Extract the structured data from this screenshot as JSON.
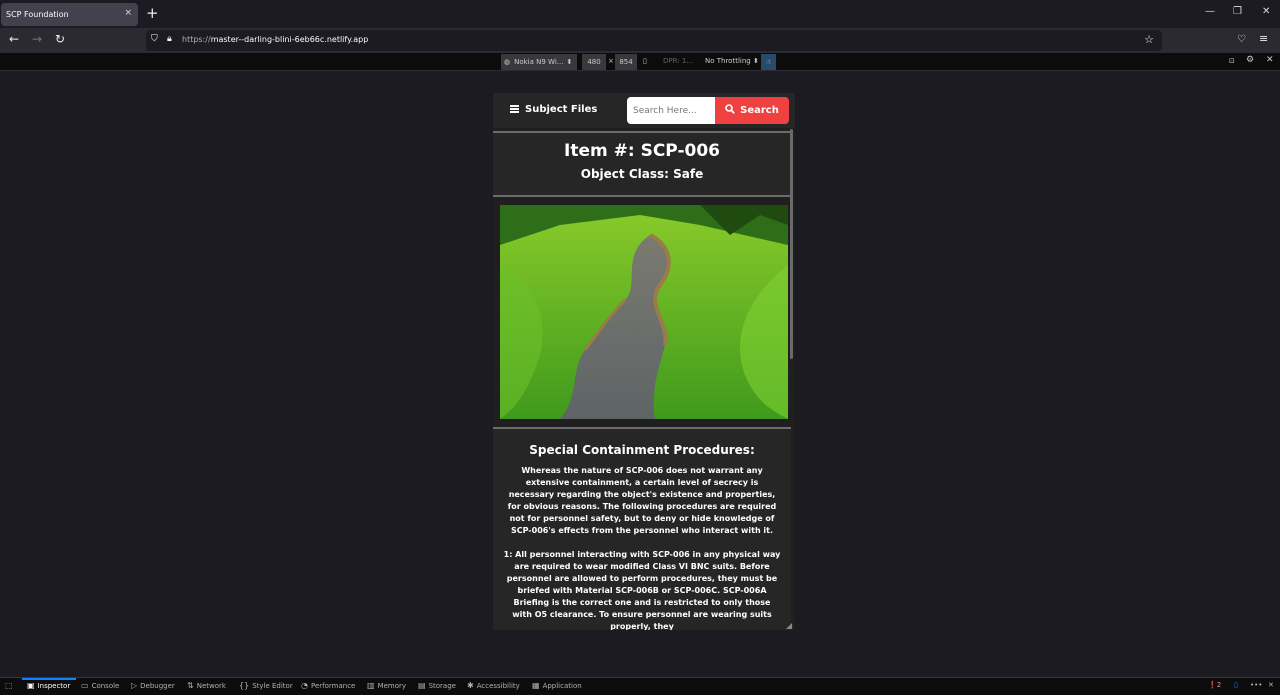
{
  "browser": {
    "tab_title": "SCP Foundation",
    "tab_close": "×",
    "new_tab": "+",
    "url_scheme": "https://",
    "url_host": "master--darling-blini-6eb66c.netlify.app"
  },
  "rdm": {
    "device": "Nokia N9 Wi...",
    "width": "480",
    "x": "×",
    "height": "854",
    "dpr": "DPR: 1...",
    "throttle": "No Throttling"
  },
  "site": {
    "nav": {
      "subject_files": "Subject Files",
      "search_placeholder": "Search Here...",
      "search_button": "Search"
    },
    "item_title": "Item #: SCP-006",
    "object_class": "Object Class: Safe",
    "containment_heading": "Special Containment Procedures:",
    "paragraph_1": "Whereas the nature of SCP-006 does not warrant any extensive containment, a certain level of secrecy is necessary regarding the object's existence and properties, for obvious reasons. The following procedures are required not for personnel safety, but to deny or hide knowledge of SCP-006's effects from the personnel who interact with it.",
    "paragraph_2": "1: All personnel interacting with SCP-006 in any physical way are required to wear modified Class VI BNC suits. Before personnel are allowed to perform procedures, they must be briefed with Material SCP-006B or SCP-006C. SCP-006A Briefing is the correct one and is restricted to only those with O5 clearance. To ensure personnel are wearing suits properly, they"
  },
  "devtools": {
    "tabs": [
      "Inspector",
      "Console",
      "Debugger",
      "Network",
      "Style Editor",
      "Performance",
      "Memory",
      "Storage",
      "Accessibility",
      "Application"
    ],
    "error_count": "2"
  },
  "colors": {
    "accent": "#f04141",
    "page_bg": "#1f1f1f",
    "panel_bg": "#262626"
  }
}
